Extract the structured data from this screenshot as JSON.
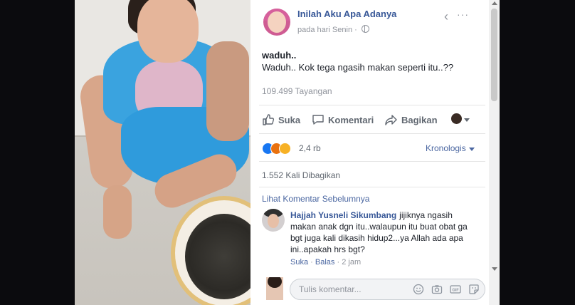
{
  "post": {
    "page_name": "Inilah Aku Apa Adanya",
    "time": "pada hari Senin",
    "title": "waduh..",
    "body": "Waduh.. Kok tega ngasih makan seperti itu..??",
    "views": "109.499 Tayangan"
  },
  "actions": {
    "like": "Suka",
    "comment": "Komentari",
    "share": "Bagikan"
  },
  "reactions": {
    "count": "2,4 rb",
    "sort_label": "Kronologis",
    "shares": "1.552 Kali Dibagikan",
    "types": [
      "like-icon",
      "angry-icon",
      "wow-icon"
    ],
    "colors": {
      "like": "#1877f2",
      "angry": "#e9710f",
      "wow": "#f7b125"
    }
  },
  "comments": {
    "previous_label": "Lihat Komentar Sebelumnya",
    "items": [
      {
        "author": "Hajjah Yusneli Sikumbang",
        "text": "jijiknya ngasih makan anak dgn itu..walaupun itu buat obat ga bgt juga kali dikasih hidup2...ya Allah ada apa ini..apakah hrs bgt?",
        "like": "Suka",
        "reply": "Balas",
        "time": "2 jam"
      }
    ],
    "compose_placeholder": "Tulis komentar..."
  },
  "colors": {
    "link": "#385898",
    "text": "#1d2129",
    "muted": "#90949c",
    "backdrop": "#0b0b0e"
  }
}
